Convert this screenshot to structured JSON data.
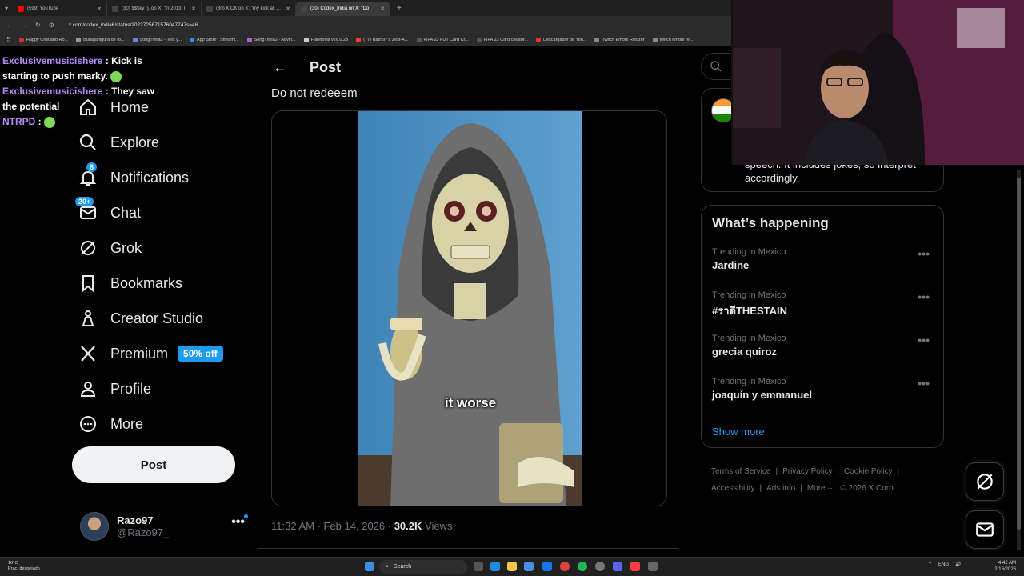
{
  "browser": {
    "tabs": [
      {
        "title": "(599) YouTube",
        "color": "#ff0000",
        "active": false
      },
      {
        "title": "(30) $$$ky :), on X: \"in 2013, I",
        "color": "#444444",
        "active": false
      },
      {
        "title": "(30) KICK on X: \"my kick all sto",
        "color": "#444444",
        "active": false
      },
      {
        "title": "(30) Codex_India on X: \"Do",
        "color": "#444444",
        "active": true
      }
    ],
    "url": "x.com/codex_india6/status/2022725671576047747s=46",
    "bookmarks": [
      {
        "label": "Happy Cristiano Ro...",
        "color": "#cc3333"
      },
      {
        "label": "Buraga figura de to...",
        "color": "#999999"
      },
      {
        "label": "SongTrivia2 - Test y...",
        "color": "#6688cc"
      },
      {
        "label": "App Store / Streami...",
        "color": "#3388ff"
      },
      {
        "label": "SongTrivia2 - Advin...",
        "color": "#aa66cc"
      },
      {
        "label": "Flatetools v26.0.28",
        "color": "#cccccc"
      },
      {
        "label": "(77) Razo97's Zest-A...",
        "color": "#ff3333"
      },
      {
        "label": "FIFA 23 FUT Card Cr...",
        "color": "#555555"
      },
      {
        "label": "FIFA 23 Card creator...",
        "color": "#555555"
      },
      {
        "label": "Descargador de You...",
        "color": "#dd3333"
      },
      {
        "label": "Twitch Emote Resizer",
        "color": "#888888"
      },
      {
        "label": "twitch emote re...",
        "color": "#888888"
      }
    ]
  },
  "chat": [
    {
      "name": "Exclusivemusicishere",
      "sep": " : ",
      "msg": "Kick is starting to push marky.",
      "emote": true
    },
    {
      "name": "Exclusivemusicishere",
      "sep": " : ",
      "msg": "They saw the potential",
      "emote": false
    },
    {
      "name": "NTRPD",
      "sep": " : ",
      "msg": "",
      "emote": true
    }
  ],
  "nav": {
    "items": [
      {
        "label": "Home",
        "icon": "home-icon"
      },
      {
        "label": "Explore",
        "icon": "search-icon"
      },
      {
        "label": "Notifications",
        "icon": "bell-icon",
        "badge": "8"
      },
      {
        "label": "Chat",
        "icon": "mail-icon",
        "badge": "20+"
      },
      {
        "label": "Grok",
        "icon": "grok-icon"
      },
      {
        "label": "Bookmarks",
        "icon": "bookmark-icon"
      },
      {
        "label": "Creator Studio",
        "icon": "creator-studio-icon"
      },
      {
        "label": "Premium",
        "icon": "x-logo-icon",
        "pill": "50% off"
      },
      {
        "label": "Profile",
        "icon": "person-icon"
      },
      {
        "label": "More",
        "icon": "more-circle-icon"
      }
    ],
    "post_button": "Post"
  },
  "profile": {
    "name": "Razo97",
    "handle": "@Razo97_",
    "more": "•••"
  },
  "post": {
    "header": "Post",
    "back": "←",
    "text": "Do not redeeem",
    "caption": "it worse",
    "time": "11:32 AM · Feb 14, 2026 · ",
    "views_count": "30.2K",
    "views_label": " Views"
  },
  "right": {
    "search_placeholder": "Se",
    "card_text": "speech. It includes jokes, so interpret accordingly.",
    "happening_title": "What’s happening",
    "trends": [
      {
        "context": "Trending in Mexico",
        "topic": "Jardine"
      },
      {
        "context": "Trending in Mexico",
        "topic": "#ราดีTHESTAIN"
      },
      {
        "context": "Trending in Mexico",
        "topic": "grecia quiroz"
      },
      {
        "context": "Trending in Mexico",
        "topic": "joaquín y emmanuel"
      }
    ],
    "trend_more": "•••",
    "show_more": "Show more",
    "footer_line1": [
      "Terms of Service",
      "|",
      "Privacy Policy",
      "|",
      "Cookie Policy",
      "|"
    ],
    "footer_line2": [
      "Accessibility",
      "|",
      "Ads info",
      "|",
      "More ···",
      "© 2026 X Corp."
    ]
  },
  "taskbar": {
    "weather_temp": "16°C",
    "weather_desc": "Prac. despejado",
    "search": "Search",
    "lang": "ENG",
    "time": "4:42 AM",
    "date": "2/16/2026"
  },
  "colors": {
    "accent": "#1d9bf0",
    "chat_name": "#b78af5",
    "background": "#000000"
  }
}
